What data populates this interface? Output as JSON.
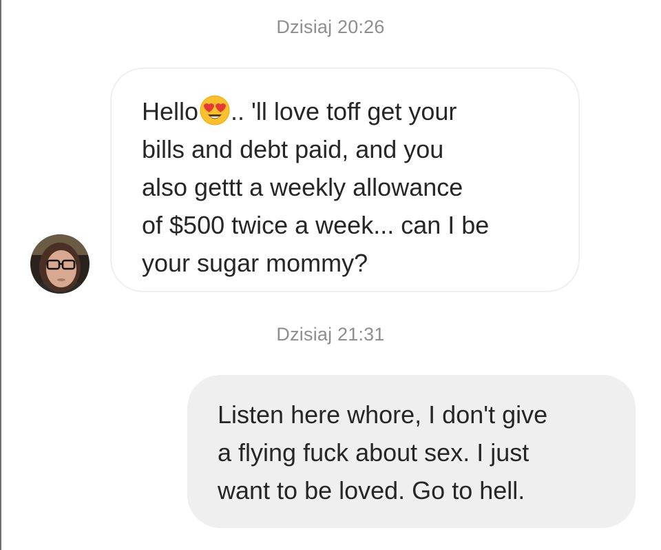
{
  "timestamps": [
    "Dzisiaj 20:26",
    "Dzisiaj 21:31"
  ],
  "incoming_message": {
    "line1_before_emoji": "Hello",
    "emoji": "heart-eyes-emoji",
    "line1_after_emoji": ".. 'll love toff get your",
    "lines": [
      "bills and debt paid, and you",
      "also gettt a weekly allowance",
      "of $500 twice a week... can I be",
      "your sugar mommy?"
    ]
  },
  "outgoing_message": {
    "lines": [
      "Listen here whore, I don't give",
      "a flying fuck about sex. I just",
      "want to be loved. Go to hell."
    ]
  },
  "colors": {
    "timestamp": "#8e8e8e",
    "text": "#262626",
    "incoming_border": "#efefef",
    "outgoing_bg": "#efefef"
  }
}
